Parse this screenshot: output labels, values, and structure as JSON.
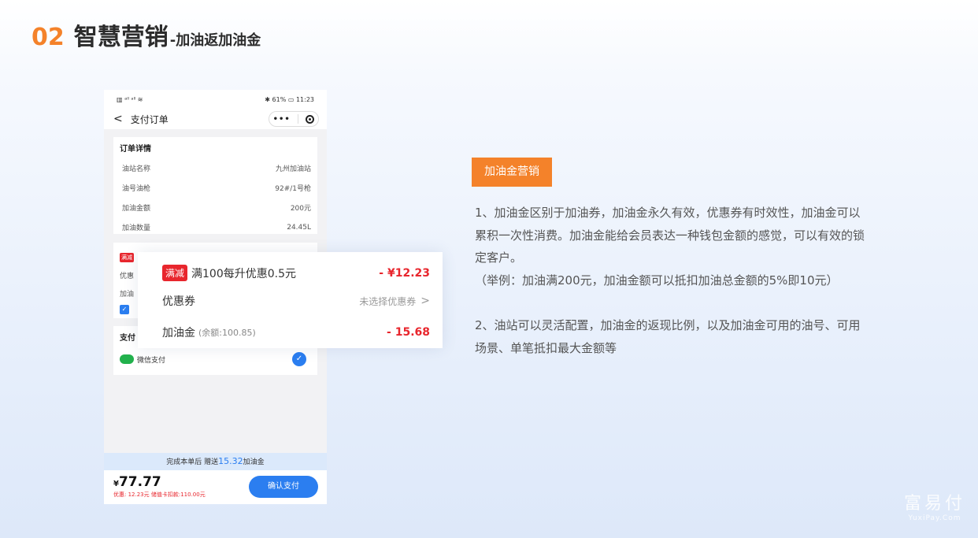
{
  "header": {
    "num": "02",
    "title": "智慧营销",
    "subtitle": "-加油返加油金"
  },
  "phone": {
    "status_left": "▥ ᵃˡˡ ᵃˡˡ ≋",
    "status_right": "✱ 61% ▭ 11:23",
    "nav_title": "支付订单",
    "detail": {
      "title": "订单详情",
      "rows": [
        {
          "label": "油站名称",
          "value": "九州加油站"
        },
        {
          "label": "油号油枪",
          "value": "92#/1号枪"
        },
        {
          "label": "加油金额",
          "value": "200元"
        },
        {
          "label": "加油数量",
          "value": "24.45L"
        }
      ]
    },
    "promo": {
      "badge": "满减",
      "l1": "优惠",
      "l2": "加油"
    },
    "pay": {
      "title": "支付",
      "method": "微信支付"
    },
    "bonus": {
      "prefix": "完成本单后 赠送",
      "amount": "15.32",
      "suffix": "加油金"
    },
    "footer": {
      "currency": "¥",
      "price": "77.77",
      "meta": "优惠: 12.23元  储值卡扣款:110.00元",
      "button": "确认支付"
    }
  },
  "popup": {
    "r1_badge": "满减",
    "r1_label": "满100每升优惠0.5元",
    "r1_value": "- ¥12.23",
    "r2_label": "优惠券",
    "r2_value": "未选择优惠券",
    "r3_label": "加油金",
    "r3_small": "(余额:100.85)",
    "r3_value": "- 15.68"
  },
  "tag": "加油金营销",
  "desc": {
    "p1": "1、加油金区别于加油券，加油金永久有效，优惠券有时效性，加油金可以累积一次性消费。加油金能给会员表达一种钱包金额的感觉，可以有效的锁定客户。",
    "p2": "（举例：加油满200元，加油金额可以抵扣加油总金额的5%即10元）",
    "p3": "2、油站可以灵活配置，加油金的返现比例，以及加油金可用的油号、可用场景、单笔抵扣最大金额等"
  },
  "watermark": {
    "cn": "富易付",
    "en": "YuxiPay.Com"
  }
}
